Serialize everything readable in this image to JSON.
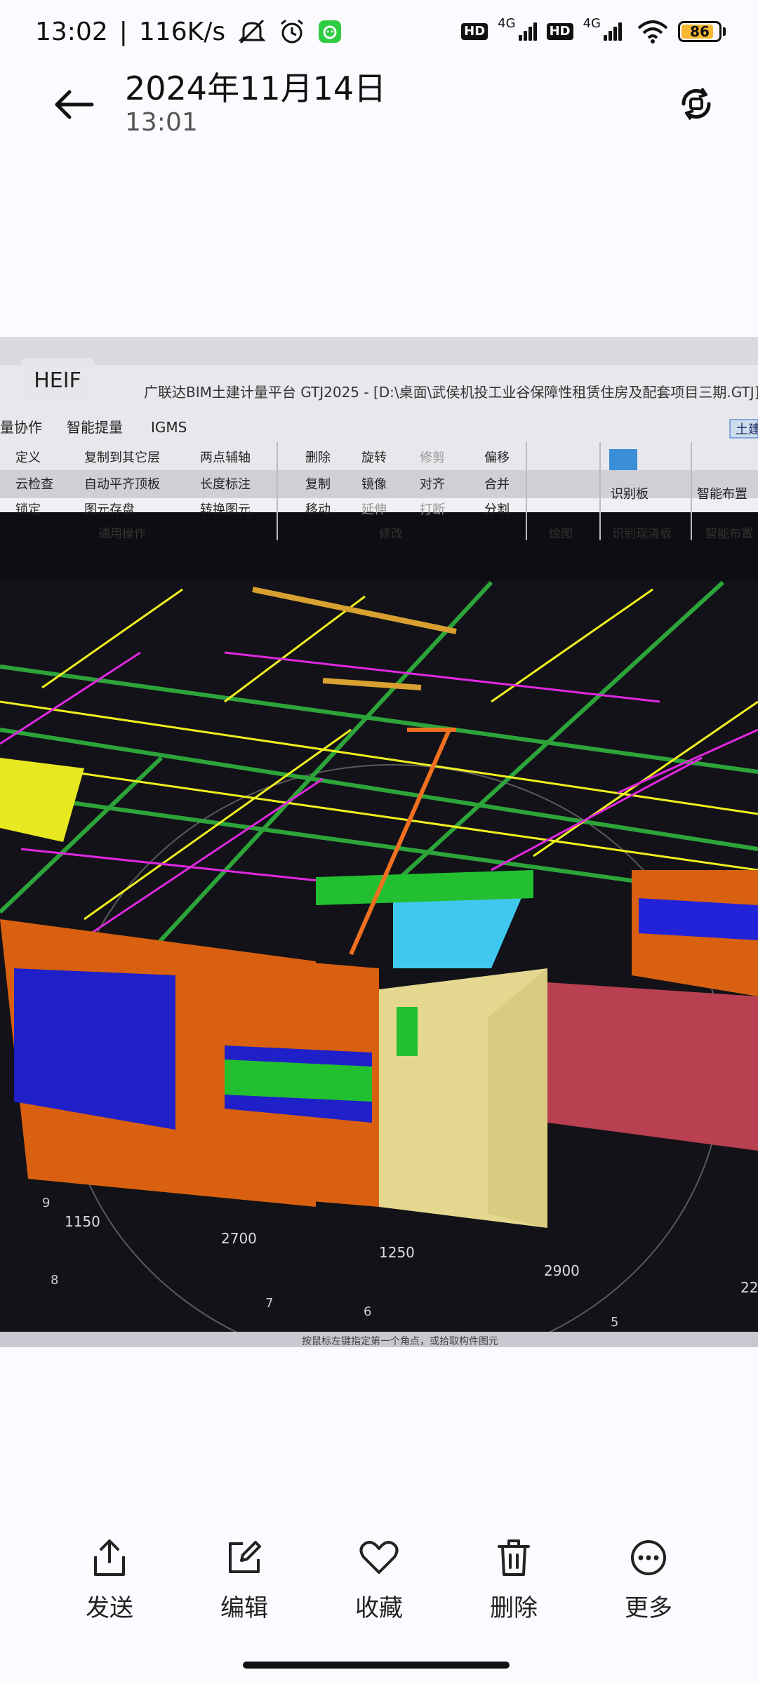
{
  "status_bar": {
    "time": "13:02",
    "speed": "116K/s",
    "network_1": "4G",
    "network_2": "4G",
    "hd_label": "HD",
    "battery": "86",
    "battery_level": 0.86,
    "battery_color": "#f7b830"
  },
  "header": {
    "title": "2024年11月14日",
    "subtitle": "13:01",
    "back_icon": "arrow-left-icon",
    "rotate_icon": "rotate-icon"
  },
  "photo": {
    "format_badge": "HEIF",
    "app_title": "广联达BIM土建计量平台 GTJ2025 - [D:\\桌面\\武侯机投工业谷保障性租赁住房及配套项目三期.GTJ]",
    "top_tabs": [
      "量协作",
      "智能提量",
      "IGMS"
    ],
    "toolbar": {
      "col1": [
        "定义",
        "云检查",
        "锁定"
      ],
      "col2": [
        "复制到其它层",
        "自动平齐顶板",
        "图元存盘"
      ],
      "col3": [
        "两点辅轴",
        "长度标注",
        "转换图元"
      ],
      "col4": [
        "删除",
        "复制",
        "移动"
      ],
      "col5": [
        "旋转",
        "镜像",
        "延伸"
      ],
      "col6": [
        "修剪",
        "对齐",
        "打断"
      ],
      "col7": [
        "偏移",
        "合并",
        "分割"
      ],
      "group_general": "通用操作",
      "group_modify": "修改",
      "group_draw": "绘图",
      "group_identify": "识别现浇板",
      "group_smart": "智能布置",
      "identify_board": "识别板",
      "smart_layout": "智能布置",
      "right_tab": "土建"
    },
    "dimensions": [
      "1150",
      "2700",
      "1250",
      "2900",
      "22"
    ],
    "axis_marks": [
      "9",
      "8",
      "7",
      "6",
      "5"
    ],
    "status_text": "按鼠标左键指定第一个角点，或拾取构件图元"
  },
  "actions": [
    {
      "label": "发送",
      "icon": "share-icon"
    },
    {
      "label": "编辑",
      "icon": "edit-icon"
    },
    {
      "label": "收藏",
      "icon": "heart-icon"
    },
    {
      "label": "删除",
      "icon": "trash-icon"
    },
    {
      "label": "更多",
      "icon": "more-icon"
    }
  ]
}
